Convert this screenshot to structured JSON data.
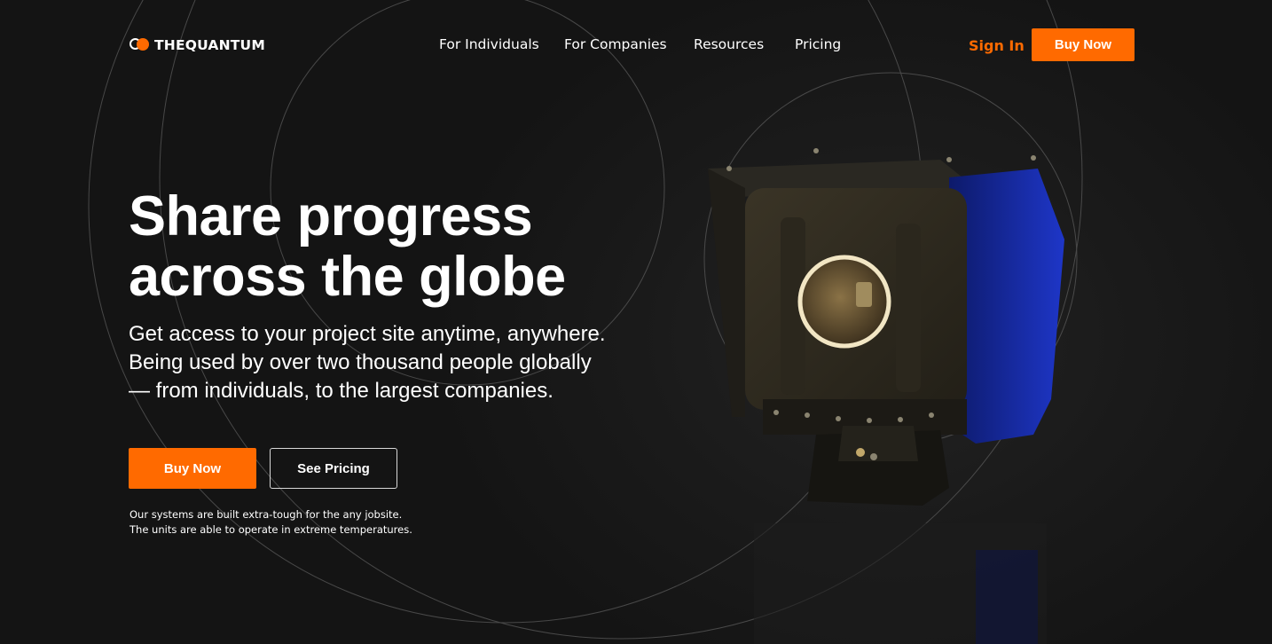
{
  "header": {
    "logo_text": "THEQUANTUM",
    "nav": [
      {
        "label": "For Individuals"
      },
      {
        "label": "For Companies"
      },
      {
        "label": "Resources"
      },
      {
        "label": "Pricing"
      }
    ],
    "sign_in_label": "Sign In",
    "buy_now_label": "Buy Now"
  },
  "hero": {
    "title_lines": [
      "Share progress",
      "across the globe"
    ],
    "subtitle_lines": [
      "Get access to your project site anytime, anywhere.",
      "Being used by over two thousand people globally",
      "— from individuals, to the largest companies."
    ],
    "primary_button": "Buy Now",
    "secondary_button": "See Pricing",
    "note_lines": [
      "Our systems are built extra-tough for the any jobsite.",
      "The units are able to operate in extreme temperatures."
    ]
  },
  "colors": {
    "accent": "#ff6a00",
    "background": "#151515",
    "text": "#ffffff"
  },
  "icons": {
    "logo": "quantum-logo-icon"
  }
}
